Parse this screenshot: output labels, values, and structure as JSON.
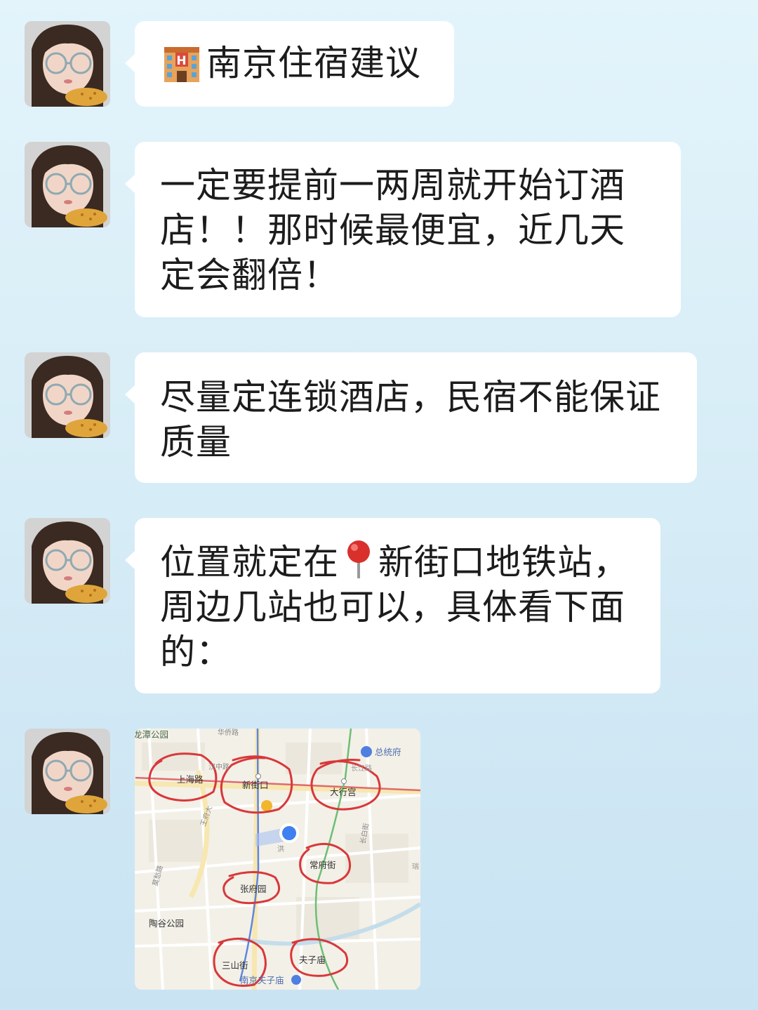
{
  "messages": [
    {
      "text": "南京住宿建议",
      "icon": "hotel-icon"
    },
    {
      "text": "一定要提前一两周就开始订酒店！！那时候最便宜，近几天定会翻倍！"
    },
    {
      "text": "尽量定连锁酒店，民宿不能保证质量"
    },
    {
      "text_before": "位置就定在",
      "icon": "pin-icon",
      "text_after": "新街口地铁站，周边几站也可以，具体看下面的："
    }
  ],
  "map": {
    "labels": {
      "park_top": "龙潭公园",
      "road_top": "华侨路",
      "road_hanzhong": "汉中路",
      "shanghai_road": "上海路",
      "xinjiekou": "新街口",
      "daxinggong": "大行宫",
      "zongtongfu": "总统府",
      "changfujie": "常府街",
      "zhangfuyuan": "张府园",
      "taogu_park": "陶谷公园",
      "sanshanjie": "三山街",
      "fuzimiao": "夫子庙",
      "nanjing_fuzimiao": "南京夫子庙",
      "wangfu": "王府大",
      "changbai": "长白街",
      "mochou": "莫愁路",
      "hong": "洪",
      "changjiang": "长江路",
      "rui": "瑞"
    },
    "circle_color": "#d8383a"
  }
}
